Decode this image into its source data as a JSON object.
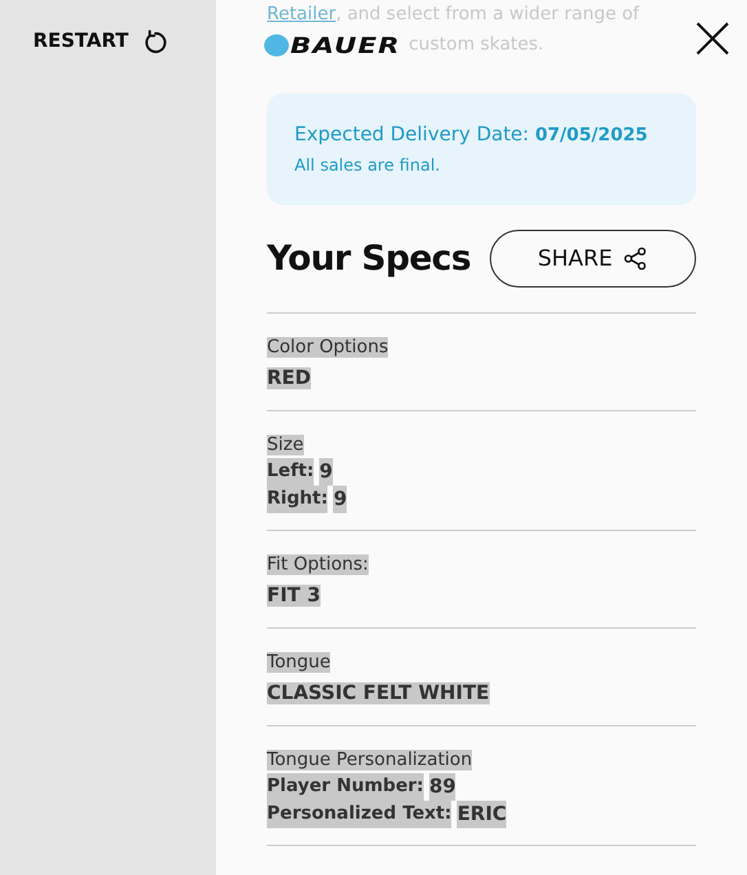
{
  "sidebar": {
    "restart": "RESTART"
  },
  "logo": "BAUER",
  "intro": {
    "link": "Retailer",
    "text_after": ", and select from a wider range of",
    "tail": "custom skates."
  },
  "delivery": {
    "label": "Expected Delivery Date:",
    "date": "07/05/2025",
    "note": "All sales are final."
  },
  "title": "Your Specs",
  "share": "SHARE",
  "specs": [
    {
      "kind": "single",
      "label": "Color Options",
      "value": "RED"
    },
    {
      "kind": "pairs",
      "label": "Size",
      "pairs": [
        {
          "key": "Left:",
          "value": "9"
        },
        {
          "key": "Right:",
          "value": "9"
        }
      ]
    },
    {
      "kind": "single",
      "label": "Fit Options:",
      "value": "FIT 3"
    },
    {
      "kind": "single",
      "label": "Tongue",
      "value": "CLASSIC FELT WHITE"
    },
    {
      "kind": "pairs",
      "label": "Tongue Personalization",
      "pairs": [
        {
          "key": "Player Number:",
          "value": "89"
        },
        {
          "key": "Personalized Text:",
          "value": "ERIC"
        }
      ]
    }
  ]
}
